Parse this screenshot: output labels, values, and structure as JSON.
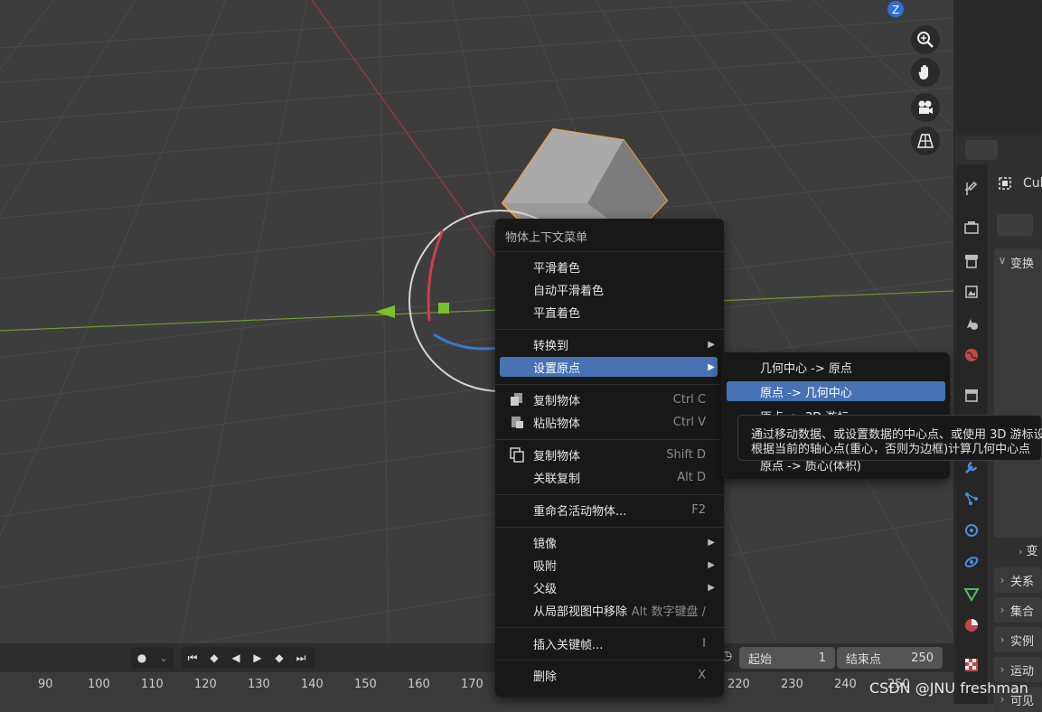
{
  "context_menu": {
    "title": "物体上下文菜单",
    "items": [
      {
        "label": "平滑着色",
        "shortcut": "",
        "icon": ""
      },
      {
        "label": "自动平滑着色",
        "shortcut": "",
        "icon": ""
      },
      {
        "label": "平直着色",
        "shortcut": "",
        "icon": ""
      },
      {
        "label": "转换到",
        "shortcut": "",
        "submenu": true
      },
      {
        "label": "设置原点",
        "shortcut": "",
        "submenu": true,
        "active": true
      },
      {
        "label": "复制物体",
        "shortcut": "Ctrl C",
        "icon": "copy-icon"
      },
      {
        "label": "粘贴物体",
        "shortcut": "Ctrl V",
        "icon": "paste-icon"
      },
      {
        "label": "复制物体",
        "shortcut": "Shift D",
        "icon": "duplicate-icon"
      },
      {
        "label": "关联复制",
        "shortcut": "Alt D",
        "icon": ""
      },
      {
        "label": "重命名活动物体...",
        "shortcut": "F2",
        "icon": ""
      },
      {
        "label": "镜像",
        "shortcut": "",
        "submenu": true
      },
      {
        "label": "吸附",
        "shortcut": "",
        "submenu": true
      },
      {
        "label": "父级",
        "shortcut": "",
        "submenu": true
      },
      {
        "label": "从局部视图中移除",
        "shortcut": "Alt 数字键盘 /",
        "icon": ""
      },
      {
        "label": "插入关键帧...",
        "shortcut": "I",
        "icon": ""
      },
      {
        "label": "删除",
        "shortcut": "X",
        "icon": ""
      }
    ]
  },
  "submenu": {
    "items": [
      {
        "label": "几何中心 -> 原点"
      },
      {
        "label": "原点 -> 几何中心",
        "active": true
      },
      {
        "label": "原点 -> 3D 游标"
      },
      {
        "label": "原点 -> 质心(体积)"
      }
    ]
  },
  "tooltip": {
    "line1": "通过移动数据、或设置数据的中心点、或使用 3D 游标设",
    "line2": "根据当前的轴心点(重心，否则为边框)计算几何中心点"
  },
  "properties": {
    "object_name": "Cub",
    "sections": [
      "变换",
      "变",
      "关系",
      "集合",
      "实例",
      "运动",
      "可见"
    ]
  },
  "timeline": {
    "start_label": "起始",
    "start_value": "1",
    "end_label": "结束点",
    "end_value": "250",
    "ticks": [
      "90",
      "100",
      "110",
      "120",
      "130",
      "140",
      "150",
      "160",
      "170",
      "220",
      "230",
      "240",
      "250"
    ]
  },
  "navigation": {
    "axis_label": "Z"
  },
  "watermark": "CSDN @JNU freshman",
  "colors": {
    "accent": "#4772b3",
    "selection_outline": "#f0a030",
    "x_axis": "#c8343c",
    "y_axis": "#7ab82c"
  }
}
